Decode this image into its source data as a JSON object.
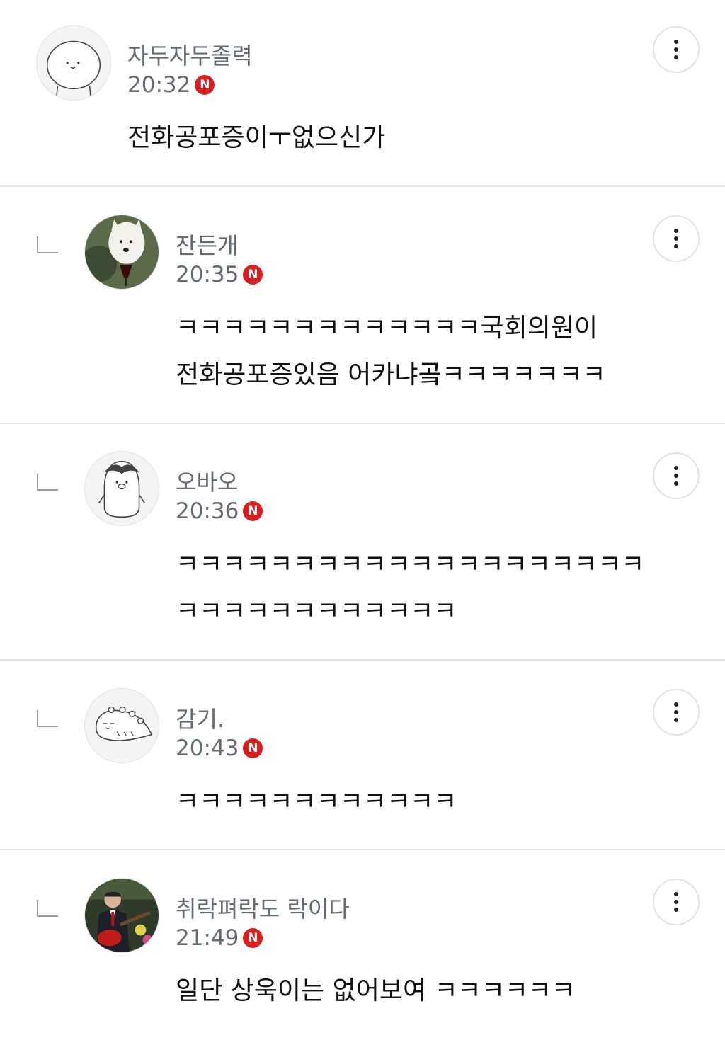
{
  "comments": [
    {
      "name": "자두자두졸력",
      "time": "20:32",
      "badge": "N",
      "text": "전화공포증이ㅜ없으신가",
      "is_reply": false,
      "avatar_icon": "round-face-character-avatar"
    },
    {
      "name": "잔든개",
      "time": "20:35",
      "badge": "N",
      "text": "ㅋㅋㅋㅋㅋㅋㅋㅋㅋㅋㅋㅋㅋ국회의원이\n전화공포증있음 어카냐곸ㅋㅋㅋㅋㅋㅋㅋ",
      "is_reply": true,
      "avatar_icon": "white-dog-photo-avatar"
    },
    {
      "name": "오바오",
      "time": "20:36",
      "badge": "N",
      "text": "ㅋㅋㅋㅋㅋㅋㅋㅋㅋㅋㅋㅋㅋㅋㅋㅋㅋㅋㅋㅋ\nㅋㅋㅋㅋㅋㅋㅋㅋㅋㅋㅋㅋ",
      "is_reply": true,
      "avatar_icon": "penguin-character-avatar"
    },
    {
      "name": "감기.",
      "time": "20:43",
      "badge": "N",
      "text": "ㅋㅋㅋㅋㅋㅋㅋㅋㅋㅋㅋㅋ",
      "is_reply": true,
      "avatar_icon": "dinosaur-character-avatar"
    },
    {
      "name": "취락펴락도 락이다",
      "time": "21:49",
      "badge": "N",
      "text": "일단 상욱이는 없어보여 ㅋㅋㅋㅋㅋㅋ",
      "is_reply": true,
      "avatar_icon": "man-with-guitar-photo-avatar"
    }
  ],
  "colors": {
    "meta_text": "#666b73",
    "badge": "#d81e1e",
    "divider": "#e6e6e6"
  }
}
